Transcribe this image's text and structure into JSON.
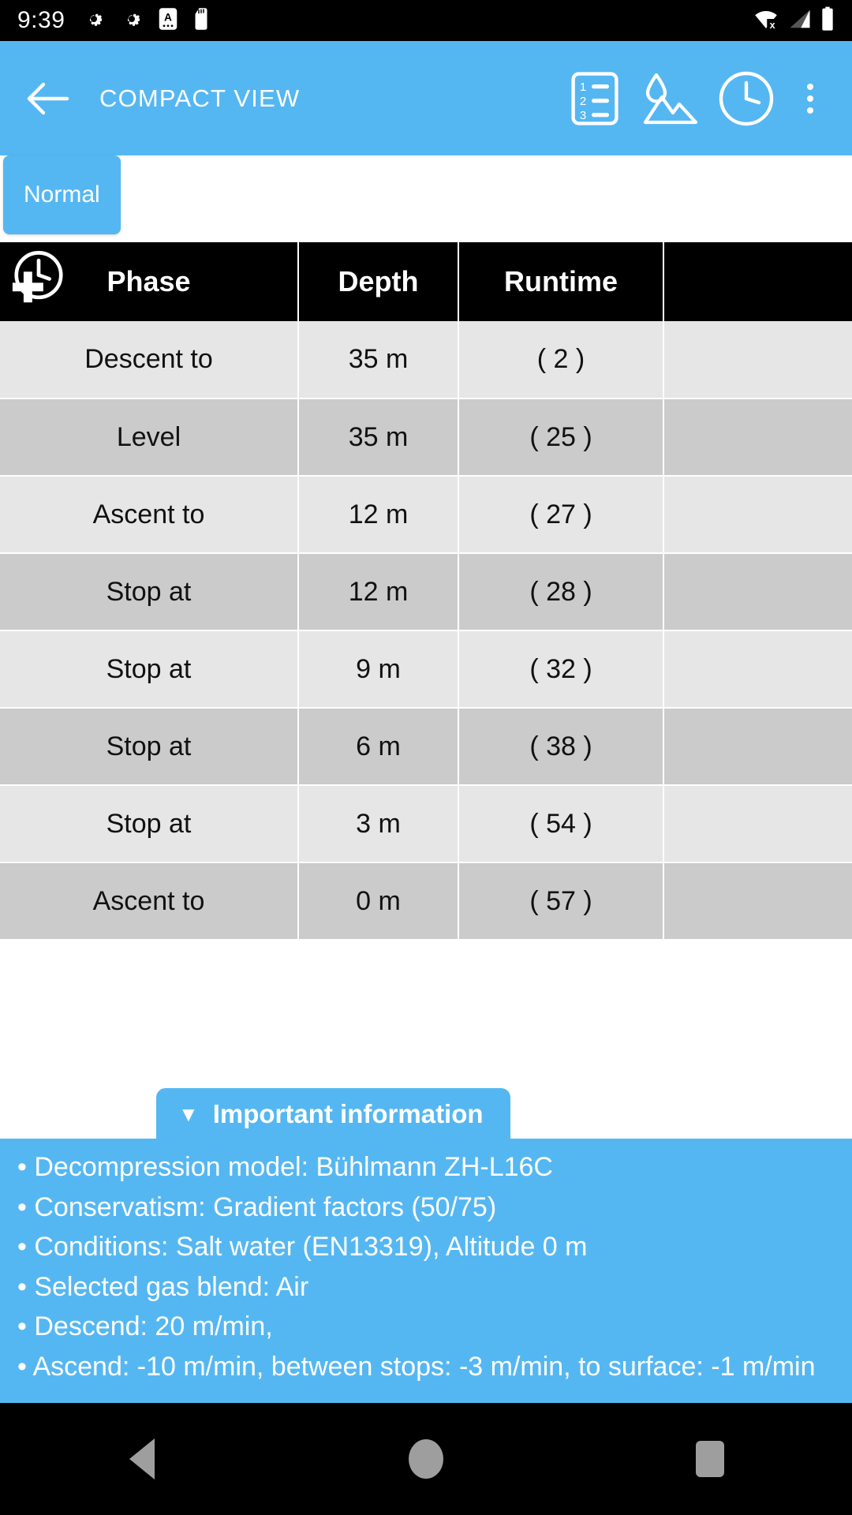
{
  "status_bar": {
    "time": "9:39",
    "left_icons": [
      "gear-icon",
      "gear-icon",
      "a-badge-icon",
      "sd-card-icon"
    ],
    "right_icons": [
      "wifi-off-icon",
      "signal-icon",
      "battery-icon"
    ]
  },
  "app_bar": {
    "back_label": "←",
    "title": "COMPACT VIEW",
    "actions": [
      {
        "name": "numbered-list-icon",
        "label": "Numbered list"
      },
      {
        "name": "water-mountain-icon",
        "label": "Altitude / salinity"
      },
      {
        "name": "clock-icon",
        "label": "Runtime"
      },
      {
        "name": "overflow-menu-icon",
        "label": "More options"
      }
    ]
  },
  "tabs": {
    "items": [
      {
        "label": "Normal",
        "selected": true
      }
    ]
  },
  "colors": {
    "accent": "#55b7f2",
    "header_bg": "#000000",
    "row_odd": "#e6e6e6",
    "row_even": "#cbcbcb"
  },
  "table": {
    "leading_icon": "clock-plus-icon",
    "columns": [
      "Phase",
      "Depth",
      "Runtime",
      ""
    ],
    "rows": [
      {
        "phase": "Descent to",
        "depth": "35 m",
        "runtime": "( 2 )",
        "extra": ""
      },
      {
        "phase": "Level",
        "depth": "35 m",
        "runtime": "( 25 )",
        "extra": ""
      },
      {
        "phase": "Ascent to",
        "depth": "12 m",
        "runtime": "( 27 )",
        "extra": ""
      },
      {
        "phase": "Stop at",
        "depth": "12 m",
        "runtime": "( 28 )",
        "extra": ""
      },
      {
        "phase": "Stop at",
        "depth": "9 m",
        "runtime": "( 32 )",
        "extra": ""
      },
      {
        "phase": "Stop at",
        "depth": "6 m",
        "runtime": "( 38 )",
        "extra": ""
      },
      {
        "phase": "Stop at",
        "depth": "3 m",
        "runtime": "( 54 )",
        "extra": ""
      },
      {
        "phase": "Ascent to",
        "depth": "0 m",
        "runtime": "( 57 )",
        "extra": ""
      }
    ]
  },
  "important_information": {
    "caret": "▼",
    "title": "Important information",
    "lines": [
      "• Decompression model: Bühlmann ZH-L16C",
      "• Conservatism: Gradient factors (50/75)",
      "• Conditions: Salt water (EN13319), Altitude 0 m",
      "• Selected gas blend: Air",
      "• Descend: 20 m/min,",
      "• Ascend: -10 m/min, between stops: -3 m/min, to surface: -1 m/min"
    ]
  },
  "nav_bar": {
    "buttons": [
      {
        "name": "nav-back-button",
        "label": "Back"
      },
      {
        "name": "nav-home-button",
        "label": "Home"
      },
      {
        "name": "nav-recents-button",
        "label": "Recents"
      }
    ]
  }
}
